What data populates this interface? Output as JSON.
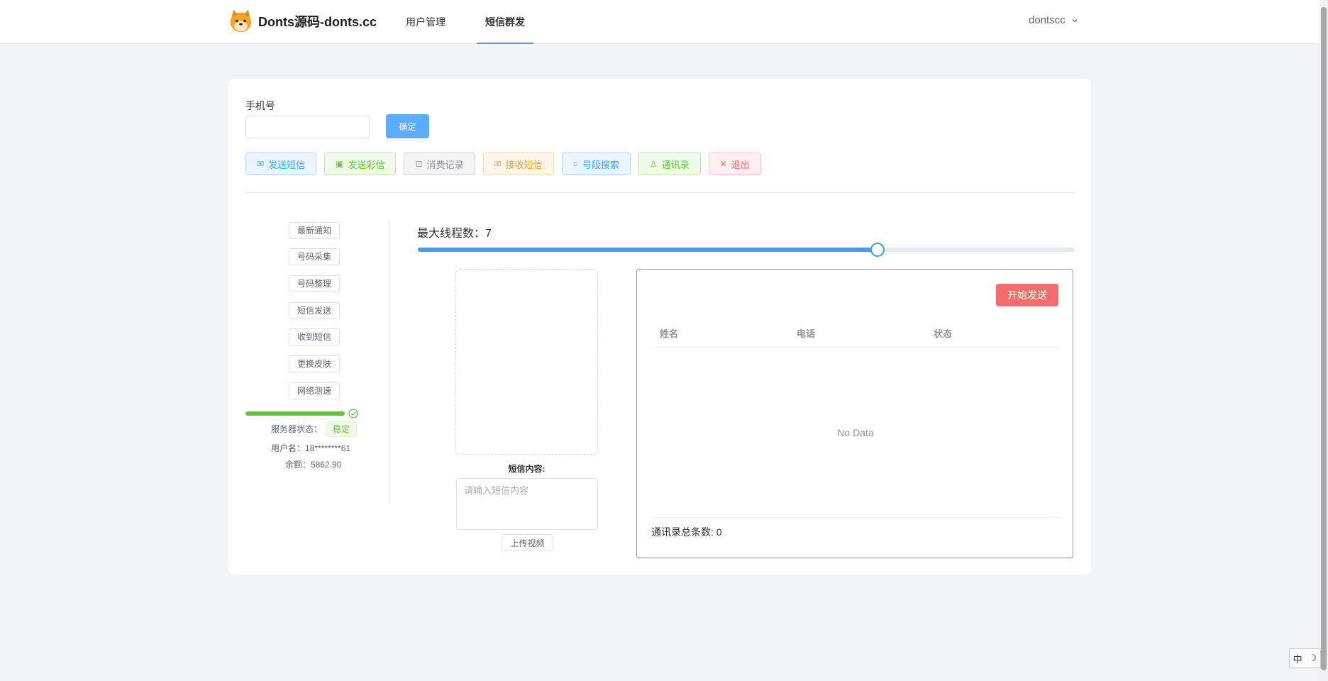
{
  "header": {
    "brand": "Donts源码-donts.cc",
    "nav": [
      {
        "label": "用户管理",
        "active": false
      },
      {
        "label": "短信群发",
        "active": true
      }
    ],
    "username": "dontscc"
  },
  "form": {
    "phone_label": "手机号",
    "phone_value": "",
    "confirm_label": "确定"
  },
  "actions": [
    {
      "label": "发送短信",
      "icon": "mail-icon",
      "color": "#409eff"
    },
    {
      "label": "发送彩信",
      "icon": "box-icon",
      "color": "#67c23a"
    },
    {
      "label": "消费记录",
      "icon": "shopping-icon",
      "color": "#909399"
    },
    {
      "label": "接收短信",
      "icon": "mail-icon",
      "color": "#e6a23c"
    },
    {
      "label": "号段搜索",
      "icon": "search-icon",
      "color": "#409eff"
    },
    {
      "label": "通讯录",
      "icon": "user-icon",
      "color": "#67c23a"
    },
    {
      "label": "退出",
      "icon": "close-icon",
      "color": "#f56c6c"
    }
  ],
  "sidebar": {
    "buttons": [
      "最新通知",
      "号码采集",
      "号码整理",
      "短信发送",
      "收到短信",
      "更换皮肤",
      "网络测速"
    ],
    "progress": 1.0,
    "server_status_label": "服务器状态：",
    "server_status_value": "稳定",
    "username_line": "用户名：18********61",
    "balance_line": "余额：5862.90"
  },
  "threads": {
    "label": "最大线程数：",
    "value": "7",
    "min": 0,
    "max": 10,
    "current": 7
  },
  "message": {
    "label": "短信内容:",
    "placeholder": "请输入短信内容",
    "upload_video": "上传视频"
  },
  "table": {
    "start_button": "开始发送",
    "columns": [
      "姓名",
      "电话",
      "状态"
    ],
    "empty_text": "No Data",
    "total_label": "通讯录总条数:",
    "total_value": "0"
  },
  "ime": {
    "lang": "中",
    "mode_icon": "moon-icon"
  }
}
